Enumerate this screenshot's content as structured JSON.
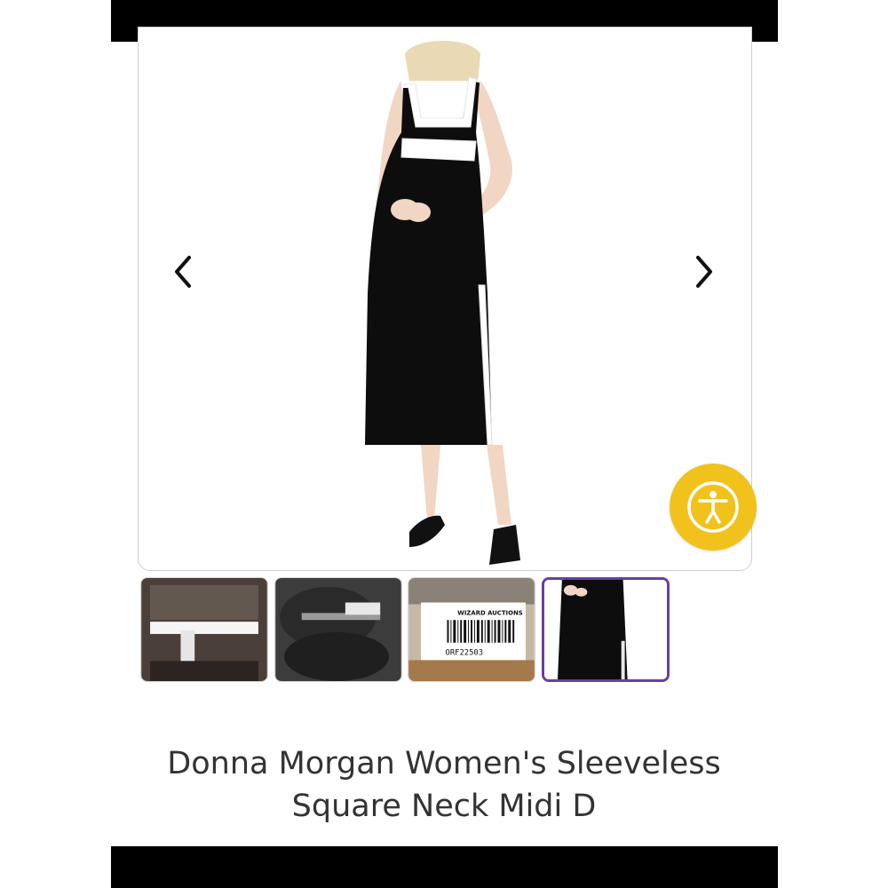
{
  "gallery": {
    "prev_icon": "chevron-left-icon",
    "next_icon": "chevron-right-icon",
    "accessibility_icon": "accessibility-icon",
    "accent_color": "#6b3fa0",
    "accessibility_color": "#f1c21b",
    "thumbnails": [
      {
        "label": ""
      },
      {
        "label": ""
      },
      {
        "label": "WIZARD AUCTIONS",
        "code": "ORF22503"
      },
      {
        "label": "",
        "selected": true
      }
    ]
  },
  "product": {
    "title_line1": "Donna Morgan Women's Sleeveless",
    "title_line2": "Square Neck Midi D"
  }
}
